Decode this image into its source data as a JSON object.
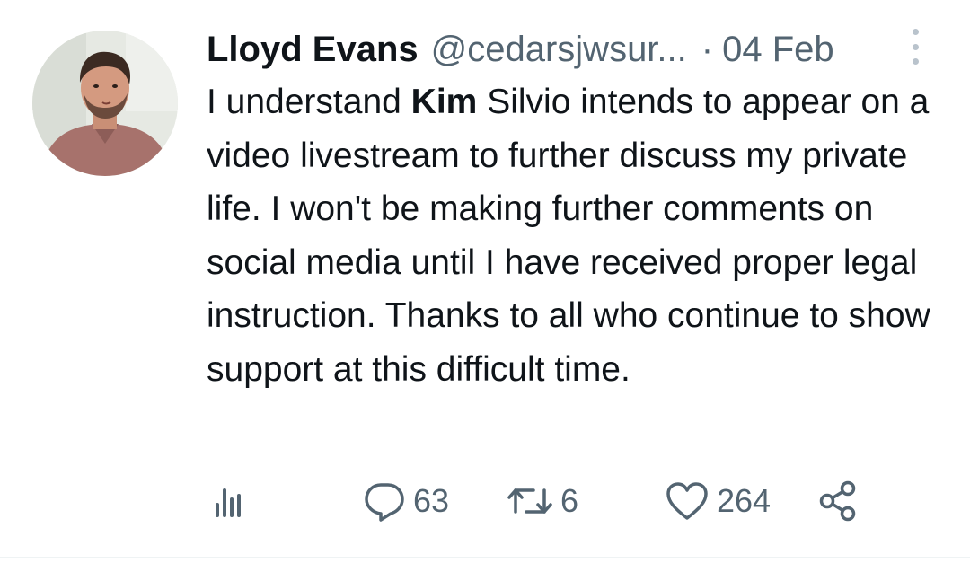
{
  "tweet": {
    "author_name": "Lloyd Evans",
    "handle": "@cedarsjwsur...",
    "separator": "·",
    "date": "04 Feb",
    "text_before": "I understand ",
    "text_bold": "Kim",
    "text_after": " Silvio intends to appear on a video livestream to further discuss my private life. I won't be making further comments on social media until I have received proper legal instruction. Thanks to all who continue to show support at this difficult time."
  },
  "actions": {
    "replies": "63",
    "retweets": "6",
    "likes": "264"
  },
  "icons": {
    "analytics": "analytics-icon",
    "reply": "reply-icon",
    "retweet": "retweet-icon",
    "like": "heart-icon",
    "share": "share-icon",
    "more": "more-vertical-icon"
  },
  "colors": {
    "text": "#0f1419",
    "secondary": "#536471"
  }
}
